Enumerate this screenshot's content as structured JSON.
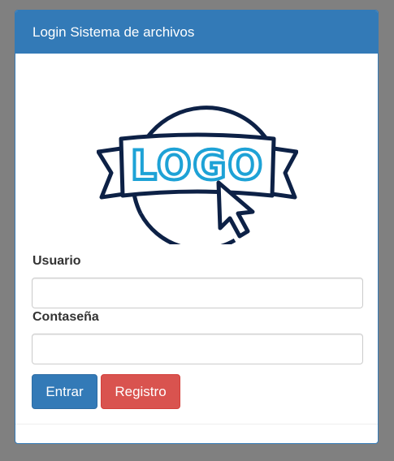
{
  "panel": {
    "title": "Login Sistema de archivos"
  },
  "logo": {
    "text": "LOGO",
    "outline_color": "#0d2146",
    "text_color": "#1ea2d6",
    "icon": "logo-badge-with-cursor-icon"
  },
  "form": {
    "username_label": "Usuario",
    "username_value": "",
    "password_label": "Contaseña",
    "password_value": ""
  },
  "buttons": {
    "submit_label": "Entrar",
    "register_label": "Registro"
  },
  "colors": {
    "primary": "#337ab7",
    "danger": "#d9534f",
    "background": "#808080"
  }
}
